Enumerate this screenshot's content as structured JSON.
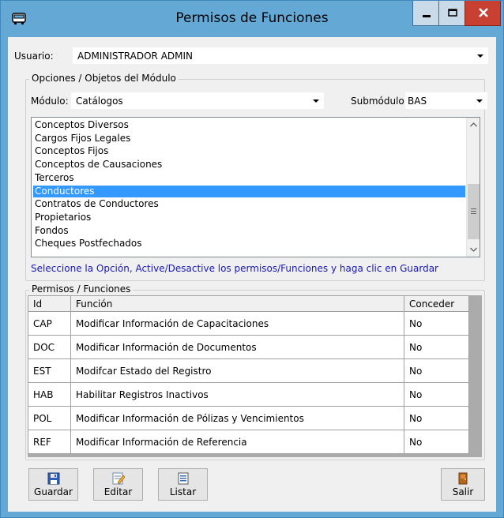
{
  "window": {
    "title": "Permisos de Funciones",
    "icon": "bus-icon",
    "controls": [
      "minimize-icon",
      "maximize-icon",
      "close-icon"
    ]
  },
  "usuario": {
    "label": "Usuario:",
    "value": "ADMINISTRADOR  ADMIN"
  },
  "opciones": {
    "title": "Opciones / Objetos del Módulo",
    "modulo_label": "Módulo:",
    "modulo_value": "Catálogos",
    "submodulo_label": "Submódulo:",
    "submodulo_value": "BAS",
    "items": [
      "Conceptos Diversos",
      "Cargos Fijos Legales",
      "Conceptos Fijos",
      "Conceptos de Causaciones",
      "Terceros",
      "Conductores",
      "Contratos de Conductores",
      "Propietarios",
      "Fondos",
      "Cheques Postfechados"
    ],
    "selected_item": "Conductores",
    "hint": "Seleccione la Opción, Active/Desactive los permisos/Funciones y haga clic en Guardar"
  },
  "permisos": {
    "title": "Permisos / Funciones",
    "columns": [
      "Id",
      "Función",
      "Conceder"
    ],
    "rows": [
      {
        "id": "CAP",
        "funcion": "Modificar Información de Capacitaciones",
        "conceder": "No"
      },
      {
        "id": "DOC",
        "funcion": "Modificar Información de Documentos",
        "conceder": "No"
      },
      {
        "id": "EST",
        "funcion": "Modifcar Estado del Registro",
        "conceder": "No"
      },
      {
        "id": "HAB",
        "funcion": "Habilitar Registros Inactivos",
        "conceder": "No"
      },
      {
        "id": "POL",
        "funcion": "Modificar Información de Pólizas y Vencimientos",
        "conceder": "No"
      },
      {
        "id": "REF",
        "funcion": "Modificar Información de Referencia",
        "conceder": "No"
      }
    ]
  },
  "buttons": {
    "guardar": "Guardar",
    "editar": "Editar",
    "listar": "Listar",
    "salir": "Salir"
  },
  "colors": {
    "title_bar": "#64a8d6",
    "selection": "#3399ff",
    "hint_text": "#1a1ab0",
    "close_button": "#c84031"
  }
}
